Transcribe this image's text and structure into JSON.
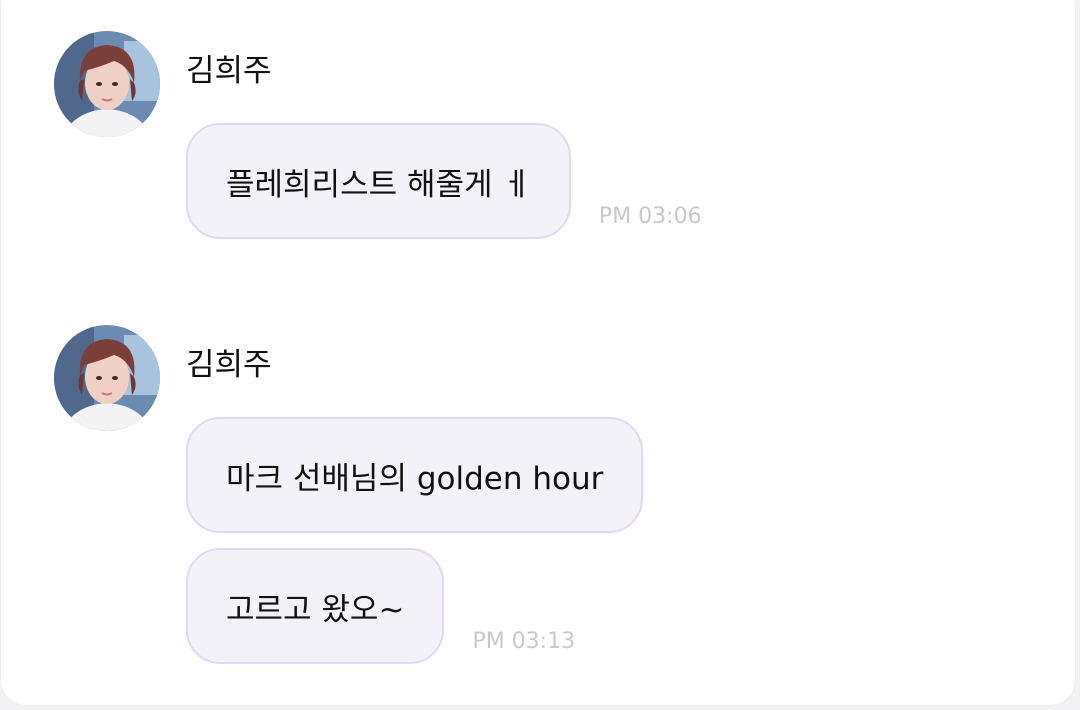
{
  "messages": [
    {
      "sender": "김희주",
      "bubbles": [
        {
          "text": "플레희리스트 해줄게 ㅔ",
          "time": "PM 03:06"
        }
      ]
    },
    {
      "sender": "김희주",
      "bubbles": [
        {
          "text": "마크 선배님의 golden hour",
          "time": ""
        },
        {
          "text": "고르고 왔오~",
          "time": "PM 03:13"
        }
      ]
    }
  ],
  "colors": {
    "bubble_bg": "#f2f2f8",
    "bubble_border": "#e2d6f3",
    "time_text": "#c9c9cc"
  },
  "icons": {
    "avatar": "profile-photo"
  }
}
